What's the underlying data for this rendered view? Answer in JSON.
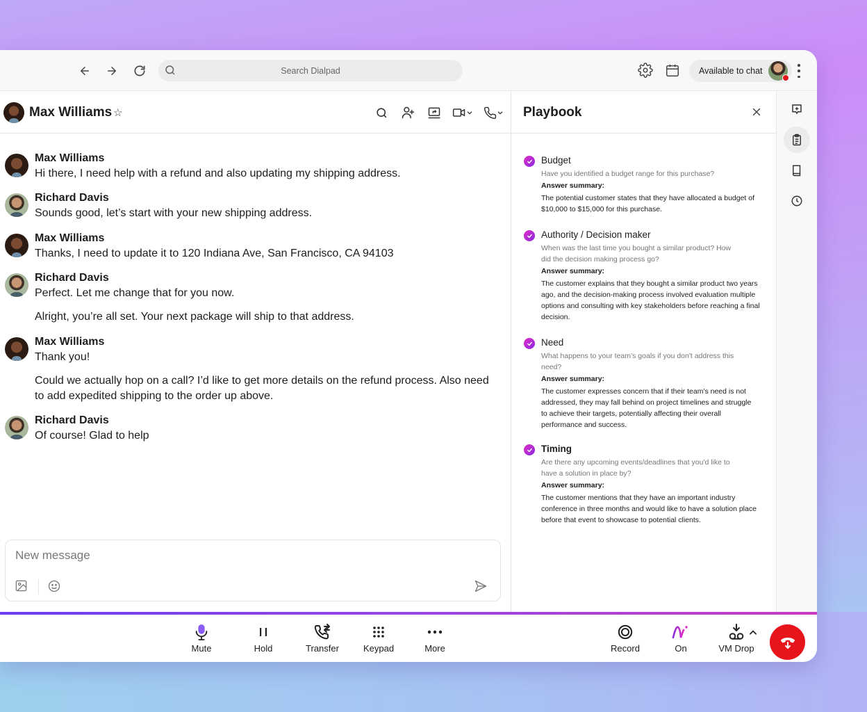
{
  "toolbar": {
    "search_placeholder": "Search Dialpad",
    "status_label": "Available to chat",
    "icons": [
      "arrow-left-icon",
      "arrow-right-icon",
      "refresh-icon",
      "search-icon",
      "gear-icon",
      "calendar-icon",
      "kebab-icon"
    ]
  },
  "chat": {
    "contact_name": "Max Williams",
    "header_icons": [
      "search-icon",
      "add-person-icon",
      "screen-share-icon",
      "video-icon",
      "phone-icon"
    ],
    "messages": [
      {
        "sender": "Max Williams",
        "texts": [
          "Hi there, I need help with a refund and also updating my shipping address."
        ]
      },
      {
        "sender": "Richard Davis",
        "texts": [
          "Sounds good, let’s start with your new shipping address."
        ]
      },
      {
        "sender": "Max Williams",
        "texts": [
          "Thanks, I need to update it to 120 Indiana Ave, San Francisco, CA 94103"
        ]
      },
      {
        "sender": "Richard Davis",
        "texts": [
          "Perfect. Let me change that for you now.",
          "Alright, you’re all set. Your next package will ship to that address."
        ]
      },
      {
        "sender": "Max Williams",
        "texts": [
          "Thank you!",
          "Could we actually hop on a call? I’d like to get more details on the refund process. Also need to add expedited shipping to the order up above."
        ]
      },
      {
        "sender": "Richard Davis",
        "texts": [
          "Of course! Glad to help"
        ]
      }
    ],
    "composer_placeholder": "New message"
  },
  "playbook": {
    "title": "Playbook",
    "answer_label": "Answer summary:",
    "items": [
      {
        "title": "Budget",
        "question": "Have you identified a budget range for this purchase?",
        "answer": "The potential customer states that they have allocated a budget of $10,000 to $15,000 for this purchase.",
        "checked": true
      },
      {
        "title": "Authority / Decision maker",
        "question": "When was the last time you bought a similar product? How did the decision making process go?",
        "answer": "The customer explains that they bought a similar product two years ago, and the decision-making process involved evaluation multiple options and consulting with key stakeholders before reaching a final decision.",
        "checked": true
      },
      {
        "title": "Need",
        "question": "What happens to your team’s goals if you don't address this need?",
        "answer": "The customer expresses concern that if their team's need is not addressed, they may fall behind on project timelines and struggle to achieve their targets, potentially affecting their overall performance and success.",
        "checked": true
      },
      {
        "title": "Timing",
        "question": "Are there any upcoming events/deadlines that you'd like to have a solution in place by?",
        "answer": "The customer mentions that they have an important industry conference in three months and would like to have a solution place before that event to showcase to potential clients.",
        "checked": true
      }
    ]
  },
  "rail": {
    "items": [
      "ai-note-icon",
      "clipboard-icon",
      "book-icon",
      "clock-icon"
    ],
    "active_index": 1
  },
  "callbar": {
    "buttons": [
      {
        "label": "Mute",
        "icon": "microphone-icon"
      },
      {
        "label": "Hold",
        "icon": "pause-icon"
      },
      {
        "label": "Transfer",
        "icon": "phone-transfer-icon"
      },
      {
        "label": "Keypad",
        "icon": "keypad-icon"
      },
      {
        "label": "More",
        "icon": "more-icon"
      },
      {
        "label": "Record",
        "icon": "record-icon"
      },
      {
        "label": "On",
        "icon": "ai-icon"
      },
      {
        "label": "VM Drop",
        "icon": "voicemail-drop-icon"
      }
    ],
    "hangup_icon": "hang-up-icon"
  },
  "colors": {
    "accent_purple": "#8b2be2",
    "accent_magenta": "#e02cc4",
    "hangup_red": "#e8141b",
    "status_dot": "#e4171c"
  }
}
